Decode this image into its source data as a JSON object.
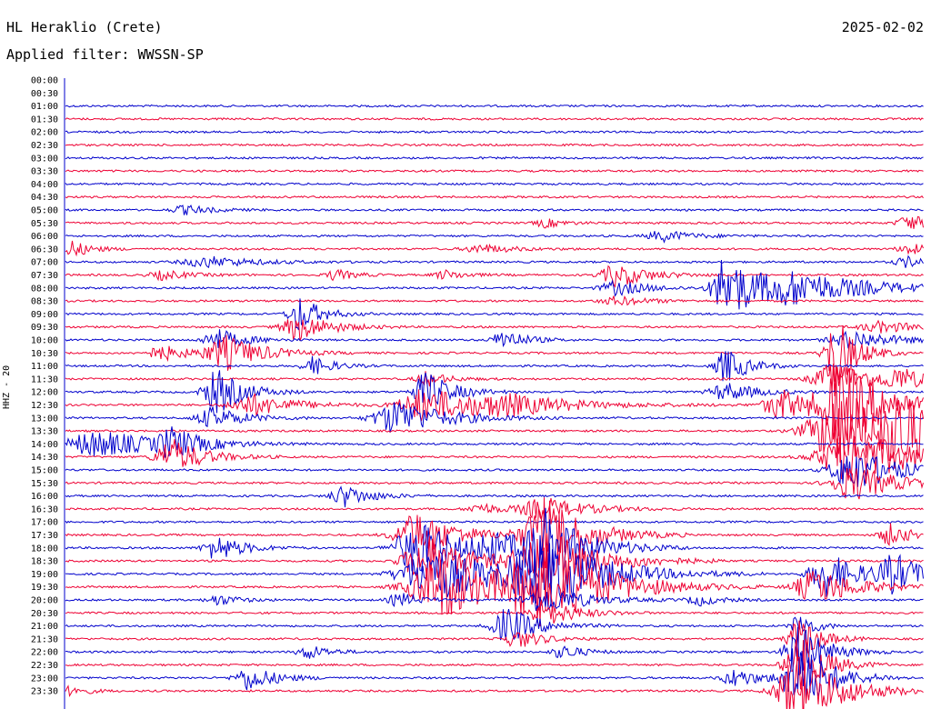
{
  "header": {
    "station": "HL Heraklio (Crete)",
    "date": "2025-02-02",
    "filter_label": "Applied filter: WWSSN-SP",
    "channel": "HHZ - 20"
  },
  "colors": {
    "trace_even": "#0000cc",
    "trace_odd": "#ee0033",
    "baseline_axis": "#0000cc",
    "text": "#000000"
  },
  "time_labels": [
    "00:00",
    "00:30",
    "01:00",
    "01:30",
    "02:00",
    "02:30",
    "03:00",
    "03:30",
    "04:00",
    "04:30",
    "05:00",
    "05:30",
    "06:00",
    "06:30",
    "07:00",
    "07:30",
    "08:00",
    "08:30",
    "09:00",
    "09:30",
    "10:00",
    "10:30",
    "11:00",
    "11:30",
    "12:00",
    "12:30",
    "13:00",
    "13:30",
    "14:00",
    "14:30",
    "15:00",
    "15:30",
    "16:00",
    "16:30",
    "17:00",
    "17:30",
    "18:00",
    "18:30",
    "19:00",
    "19:30",
    "20:00",
    "20:30",
    "21:00",
    "21:30",
    "22:00",
    "22:30",
    "23:00",
    "23:30"
  ]
}
